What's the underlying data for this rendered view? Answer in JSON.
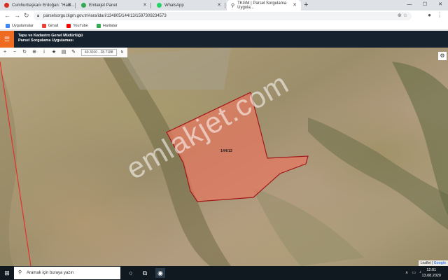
{
  "tabs": [
    {
      "title": "Cumhurbaşkanı Erdoğan: \"Hadi...",
      "color": "#d93025"
    },
    {
      "title": "Emlakjet Panel",
      "color": "#34a853"
    },
    {
      "title": "WhatsApp",
      "color": "#25d366"
    },
    {
      "title": "TKGM | Parsel Sorgulama Uygula...",
      "color": "#333333"
    }
  ],
  "address_bar": {
    "url": "parselsorgu.tkgm.gov.tr/#ara/idari/134805/144/13/1597309234573"
  },
  "bookmarks": [
    {
      "label": "Uygulamalar",
      "color": "#4285f4"
    },
    {
      "label": "Gmail",
      "color": "#ea4335"
    },
    {
      "label": "YouTube",
      "color": "#ff0000"
    },
    {
      "label": "Haritalar",
      "color": "#34a853"
    }
  ],
  "app": {
    "title_line1": "Tapu ve Kadastro Genel Müdürlüğü",
    "title_line2": "Parsel Sorgulama Uygulaması",
    "accent_color": "#ef6b1f",
    "header_color": "#16222e"
  },
  "map": {
    "coordinates": "40.3010 - 28.7188",
    "srs_label": "N",
    "parcel_label": "144/13",
    "watermark": "emlakjet.com",
    "attribution_leaflet": "Leaflet",
    "attribution_google": "Google",
    "parcel_fill": "#e8765f",
    "parcel_stroke": "#a01818"
  },
  "taskbar": {
    "search_placeholder": "Aramak için buraya yazın",
    "time": "12:01",
    "date": "13.08.2020"
  }
}
